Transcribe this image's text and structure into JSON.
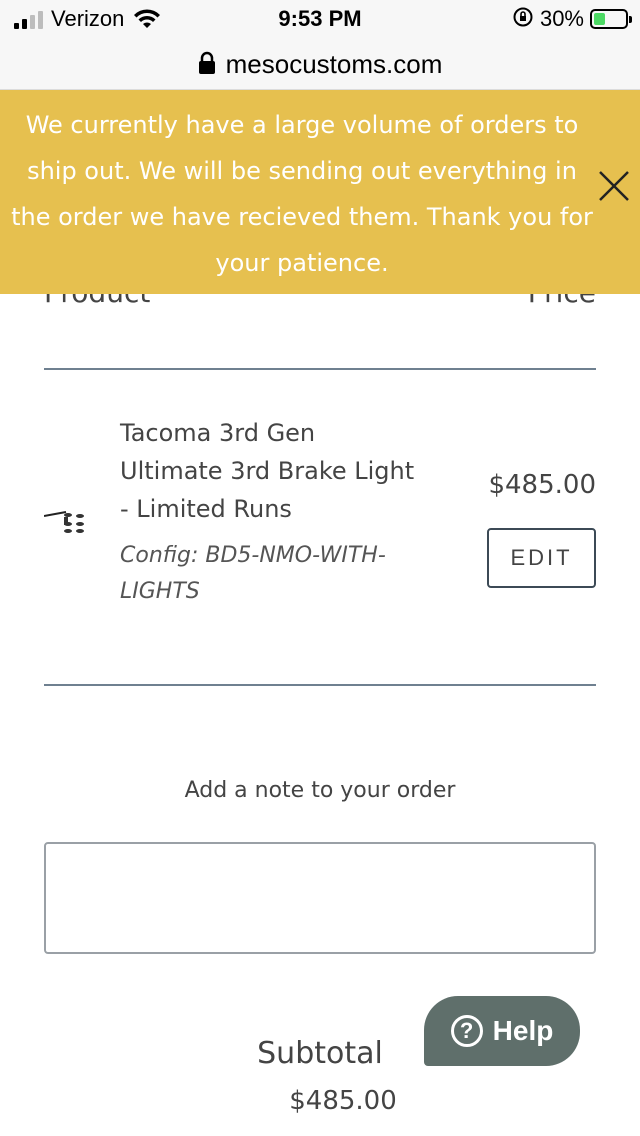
{
  "status_bar": {
    "carrier": "Verizon",
    "time": "9:53 PM",
    "battery_pct": "30%",
    "icons": [
      "signal-icon",
      "wifi-icon",
      "orientation-lock-icon",
      "battery-charging-icon"
    ]
  },
  "browser": {
    "url": "mesocustoms.com",
    "lock_icon": "lock-icon"
  },
  "announcement": {
    "text": "We currently have a large volume of orders to ship out. We will be sending out everything in the order we have recieved them. Thank you for your patience.",
    "close_icon": "close-icon",
    "background": "#e6c04f"
  },
  "cart": {
    "columns": {
      "product": "Product",
      "price": "Price"
    },
    "items": [
      {
        "title": "Tacoma 3rd Gen Ultimate 3rd Brake Light - Limited Runs",
        "config": "Config: BD5-NMO-WITH-LIGHTS",
        "price": "$485.00",
        "edit_label": "EDIT"
      }
    ],
    "note_label": "Add a note to your order",
    "note_value": "",
    "subtotal_label": "Subtotal",
    "subtotal_value": "$485.00"
  },
  "help": {
    "label": "Help",
    "icon_glyph": "?",
    "background": "#5f6f6b"
  }
}
